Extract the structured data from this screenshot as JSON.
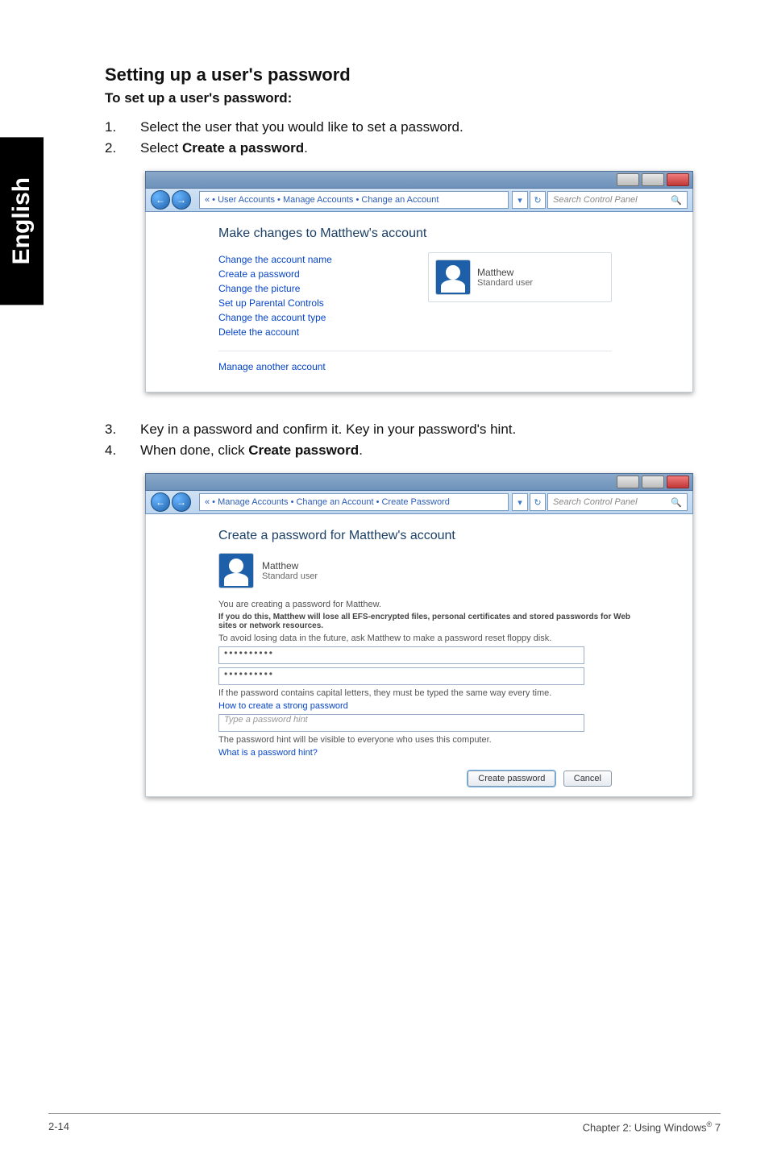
{
  "side_tab": "English",
  "heading": "Setting up a user's password",
  "subheading": "To set up a user's password:",
  "steps_a": [
    {
      "n": "1.",
      "text": "Select the user that you would like to set a password."
    },
    {
      "n": "2.",
      "pre": "Select ",
      "bold": "Create a password",
      "post": "."
    }
  ],
  "win1": {
    "back_arrow": "←",
    "fwd_arrow": "→",
    "breadcrumb": "« • User Accounts • Manage Accounts • Change an Account",
    "search_placeholder": "Search Control Panel",
    "search_icon": "🔍",
    "refresh": "↻",
    "dropdown": "▾",
    "panel_title": "Make changes to Matthew's account",
    "links": [
      "Change the account name",
      "Create a password",
      "Change the picture",
      "Set up Parental Controls",
      "Change the account type",
      "Delete the account"
    ],
    "manage_link": "Manage another account",
    "acct_name": "Matthew",
    "acct_type": "Standard user"
  },
  "steps_b": [
    {
      "n": "3.",
      "text": "Key in a password and confirm it. Key in your password's hint."
    },
    {
      "n": "4.",
      "pre": "When done, click ",
      "bold": "Create password",
      "post": "."
    }
  ],
  "win2": {
    "back_arrow": "←",
    "fwd_arrow": "→",
    "breadcrumb": "« • Manage Accounts • Change an Account • Create Password",
    "search_placeholder": "Search Control Panel",
    "search_icon": "🔍",
    "refresh": "↻",
    "dropdown": "▾",
    "panel_title": "Create a password for Matthew's account",
    "acct_name": "Matthew",
    "acct_type": "Standard user",
    "creating": "You are creating a password for Matthew.",
    "warn": "If you do this, Matthew will lose all EFS-encrypted files, personal certificates and stored passwords for Web sites or network resources.",
    "avoid": "To avoid losing data in the future, ask Matthew to make a password reset floppy disk.",
    "pw_mask": "••••••••••",
    "caps_note": "If the password contains capital letters, they must be typed the same way every time.",
    "howto": "How to create a strong password",
    "hint_placeholder": "Type a password hint",
    "hint_note": "The password hint will be visible to everyone who uses this computer.",
    "what_hint": "What is a password hint?",
    "btn_create": "Create password",
    "btn_cancel": "Cancel"
  },
  "footer": {
    "left": "2-14",
    "right_pre": "Chapter 2: Using Windows",
    "reg": "®",
    "right_post": " 7"
  }
}
